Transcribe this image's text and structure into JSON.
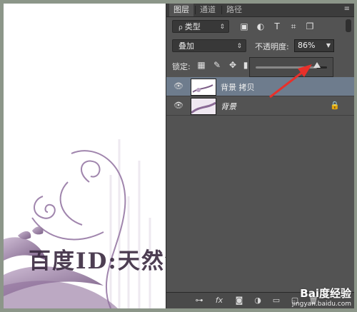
{
  "tabs": [
    "图层",
    "通道",
    "路径"
  ],
  "filter": {
    "value": "类型"
  },
  "blend_mode": {
    "value": "叠加"
  },
  "opacity": {
    "label": "不透明度:",
    "value": "86%",
    "percent": 86
  },
  "lock": {
    "label": "锁定:"
  },
  "layers": [
    {
      "name": "背景 拷贝",
      "selected": true
    },
    {
      "name": "背景",
      "locked": true
    }
  ],
  "canvas_watermark": "百度ID:天然河与你相约",
  "site_mark": {
    "brand": "Bai度经验",
    "url": "jingyan.baidu.com"
  },
  "colors": {
    "panel": "#535353",
    "selected_layer": "#6e7c8d",
    "arrow": "#e8302a"
  },
  "icons": [
    "image-filter-icon",
    "adjustment-filter-icon",
    "text-filter-icon",
    "shape-filter-icon",
    "smart-object-filter-icon",
    "lock-transparent-icon",
    "lock-paint-icon",
    "lock-move-icon",
    "eye-icon",
    "lock-icon",
    "link-icon",
    "fx-icon",
    "mask-icon",
    "adjustment-icon",
    "group-icon",
    "new-layer-icon",
    "trash-icon"
  ]
}
